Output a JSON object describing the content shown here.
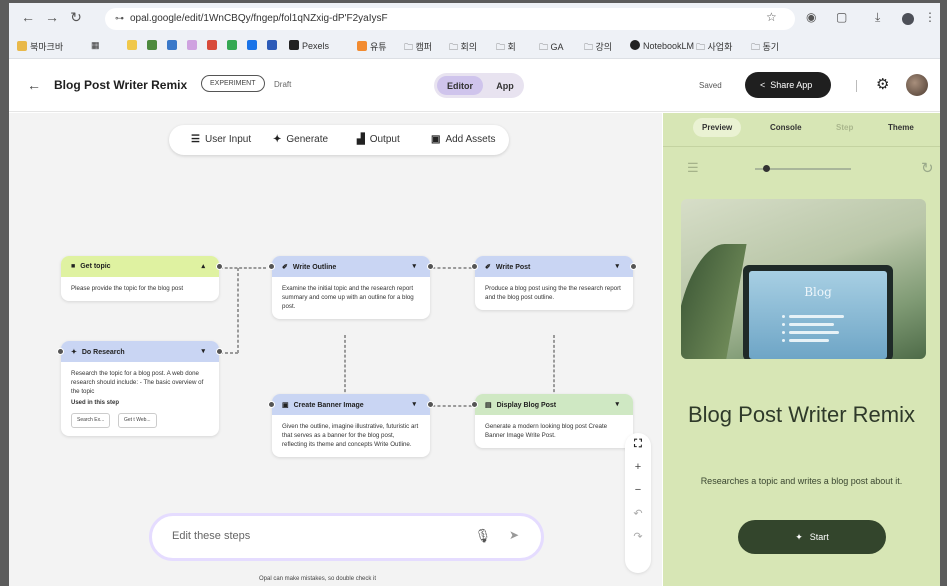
{
  "browser": {
    "url": "opal.google/edit/1WnCBQy/fngep/fol1qNZxig-dP'F2yaIysF",
    "bookmarks": [
      "북마크바",
      "Pexels",
      "유튜",
      "캠퍼",
      "회의",
      "회",
      "GA",
      "강의",
      "NotebookLM",
      "사업화",
      "동기"
    ]
  },
  "header": {
    "back_icon": "back-arrow-icon",
    "title": "Blog Post Writer Remix",
    "badge": "EXPERIMENT",
    "draft": "Draft",
    "view_tabs": {
      "editor": "Editor",
      "app": "App",
      "active": "editor"
    },
    "saved": "Saved",
    "share_label": "Share App"
  },
  "toolbar": {
    "items": [
      {
        "icon": "user-input-icon",
        "label": "User Input"
      },
      {
        "icon": "generate-icon",
        "label": "Generate"
      },
      {
        "icon": "output-icon",
        "label": "Output"
      },
      {
        "icon": "add-assets-icon",
        "label": "Add Assets"
      }
    ]
  },
  "nodes": {
    "get_topic": {
      "title": "Get topic",
      "body": "Please provide the topic for the blog post"
    },
    "do_research": {
      "title": "Do Research",
      "body": "Research the topic for a blog post. A web done research should include: - The basic overview of the topic",
      "label": "Used in this step",
      "chips": [
        "Search Ex...",
        "Get t Web..."
      ]
    },
    "write_outline": {
      "title": "Write Outline",
      "body": "Examine the initial topic and the research report summary and come up with an outline for a blog post."
    },
    "write_post": {
      "title": "Write Post",
      "body": "Produce a blog post using the the research report and the blog post outline."
    },
    "create_banner": {
      "title": "Create Banner Image",
      "body": "Given the outline, imagine illustrative, futuristic art that serves as a banner for the blog post, reflecting its theme and concepts Write Outline."
    },
    "display_post": {
      "title": "Display Blog Post",
      "body": "Generate a modern looking blog post Create Banner Image Write Post."
    }
  },
  "editor": {
    "placeholder": "Edit these steps",
    "disclaimer": "Opal can make mistakes, so double check it"
  },
  "preview": {
    "tabs": {
      "preview": "Preview",
      "console": "Console",
      "step": "Step",
      "theme": "Theme",
      "active": "preview"
    },
    "hero_text": "Blog",
    "app_title": "Blog Post Writer Remix",
    "app_description": "Researches a topic and writes a blog post about it.",
    "start_label": "Start"
  },
  "colors": {
    "user_input_header": "#dff2a1",
    "generate_header": "#c9d5f3",
    "output_header": "#cfe8c3",
    "preview_bg": "#d7e6b5",
    "start_button": "#33452c"
  }
}
